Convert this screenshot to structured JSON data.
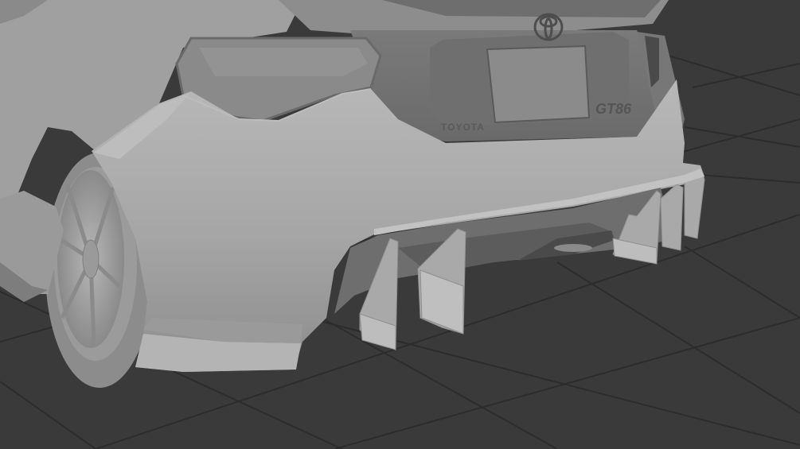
{
  "scene": {
    "kind": "3d-viewport-render",
    "colors": {
      "background": "#3a3a3a",
      "grid_line": "#2c2c2c",
      "car_body": "#a7a7a7",
      "car_shadow": "#7b7b7b",
      "car_dark": "#5f5f5f",
      "tail_light": "#8a8a8a",
      "plate": "#9a9a9a",
      "tire": "#8f8f8f"
    },
    "badges": {
      "brand_text": "TOYOTA",
      "model_text": "GT86"
    },
    "icons": [
      "toyota-logo-icon"
    ]
  }
}
